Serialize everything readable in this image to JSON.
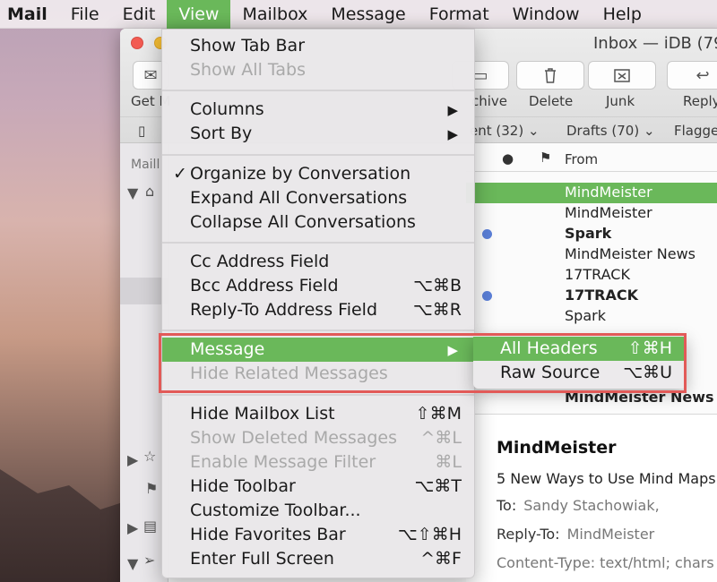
{
  "menubar": {
    "items": [
      {
        "label": "Mail",
        "kind": "app"
      },
      {
        "label": "File"
      },
      {
        "label": "Edit"
      },
      {
        "label": "View",
        "active": true
      },
      {
        "label": "Mailbox"
      },
      {
        "label": "Message"
      },
      {
        "label": "Format"
      },
      {
        "label": "Window"
      },
      {
        "label": "Help"
      }
    ]
  },
  "window": {
    "title": "Inbox — iDB (79",
    "toolbar": {
      "get_mail_label": "Get M",
      "archive_label": "chive",
      "delete_label": "Delete",
      "junk_label": "Junk",
      "reply_label": "Reply"
    },
    "favorites": {
      "sent": "ent (32)",
      "drafts": "Drafts (70)",
      "flagged": "Flagge"
    },
    "sidebar_label": "Maill",
    "list_header": {
      "from": "From"
    },
    "messages": [
      {
        "from": "MindMeister",
        "unread": false,
        "bold": false,
        "selected": true
      },
      {
        "from": "MindMeister",
        "unread": false,
        "bold": false,
        "selected": false
      },
      {
        "from": "Spark",
        "unread": true,
        "bold": true,
        "selected": false
      },
      {
        "from": "MindMeister News",
        "unread": false,
        "bold": false,
        "selected": false
      },
      {
        "from": "17TRACK",
        "unread": false,
        "bold": false,
        "selected": false
      },
      {
        "from": "17TRACK",
        "unread": true,
        "bold": true,
        "selected": false
      },
      {
        "from": "Spark",
        "unread": false,
        "bold": false,
        "selected": false
      },
      {
        "from": "MindMeister News",
        "unread": false,
        "bold": true,
        "selected": false
      }
    ],
    "preview": {
      "from": "MindMeister",
      "subject": "5 New Ways to Use Mind Maps",
      "to_label": "To:",
      "to_value": "Sandy Stachowiak,",
      "reply_to_label": "Reply-To:",
      "reply_to_value": "MindMeister",
      "content_type": "Content-Type: text/html; chars"
    }
  },
  "view_menu": {
    "show_tab_bar": "Show Tab Bar",
    "show_all_tabs": "Show All Tabs",
    "columns": "Columns",
    "sort_by": "Sort By",
    "organize": "Organize by Conversation",
    "expand_all": "Expand All Conversations",
    "collapse_all": "Collapse All Conversations",
    "cc_field": "Cc Address Field",
    "bcc_field": "Bcc Address Field",
    "bcc_shortcut": "⌥⌘B",
    "replyto_field": "Reply-To Address Field",
    "replyto_shortcut": "⌥⌘R",
    "message": "Message",
    "hide_related": "Hide Related Messages",
    "hide_mailbox_list": "Hide Mailbox List",
    "hide_mailbox_list_shortcut": "⇧⌘M",
    "show_deleted": "Show Deleted Messages",
    "show_deleted_shortcut": "^⌘L",
    "enable_filter": "Enable Message Filter",
    "enable_filter_shortcut": "⌘L",
    "hide_toolbar": "Hide Toolbar",
    "hide_toolbar_shortcut": "⌥⌘T",
    "customize_toolbar": "Customize Toolbar...",
    "hide_favorites": "Hide Favorites Bar",
    "hide_favorites_shortcut": "⌥⇧⌘H",
    "enter_full_screen": "Enter Full Screen",
    "enter_full_screen_shortcut": "^⌘F"
  },
  "message_submenu": {
    "all_headers": "All Headers",
    "all_headers_shortcut": "⇧⌘H",
    "raw_source": "Raw Source",
    "raw_source_shortcut": "⌥⌘U"
  },
  "colors": {
    "highlight": "#6ab85a",
    "annotation_box": "#e25a58",
    "unread_dot": "#5a7fd8"
  }
}
